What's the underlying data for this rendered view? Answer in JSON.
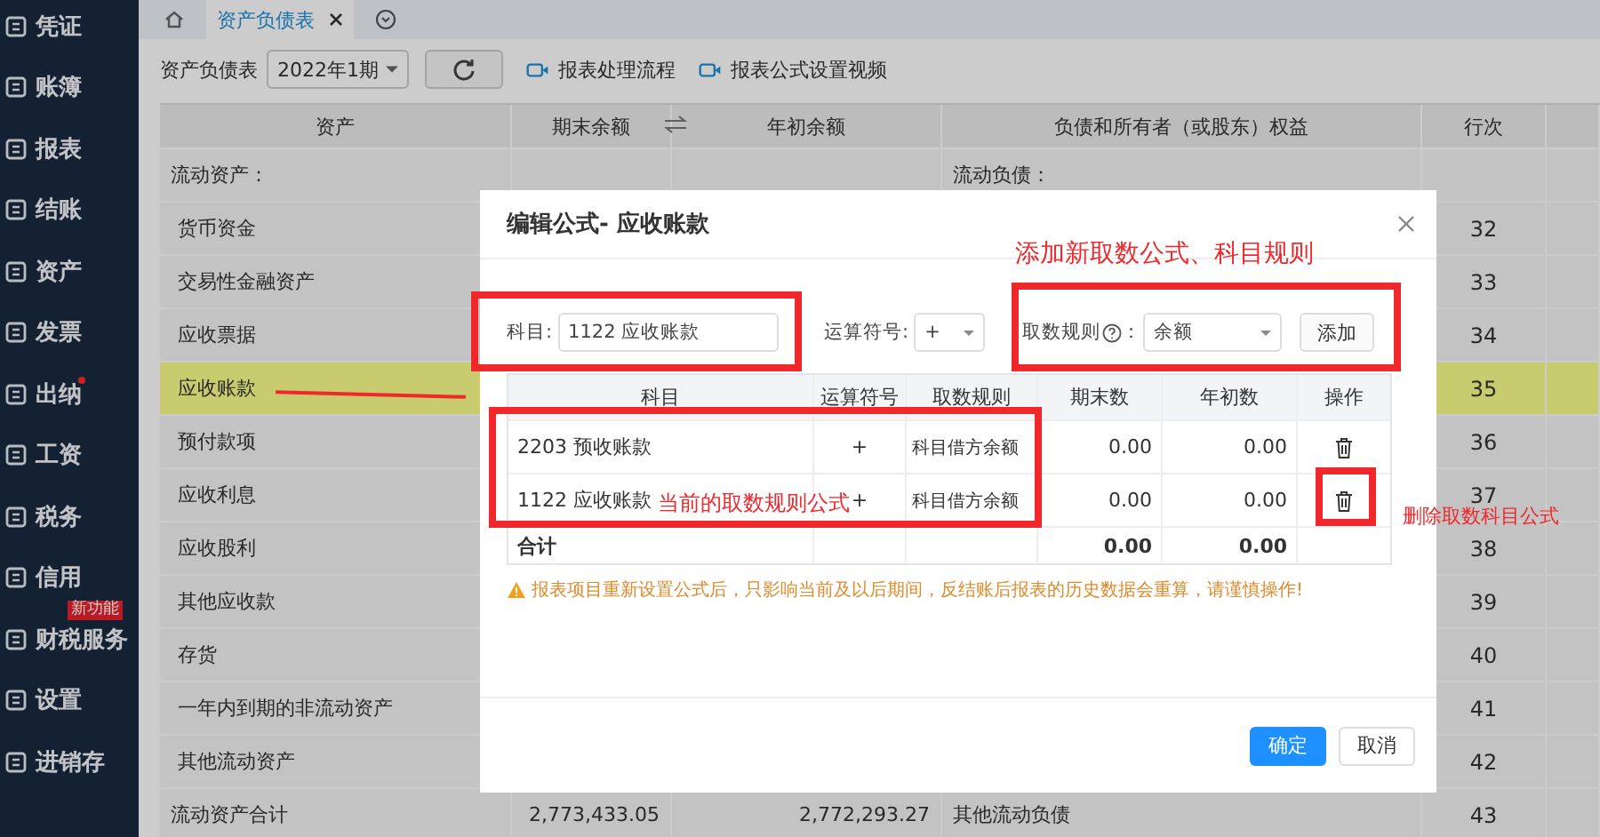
{
  "sidebar": {
    "items": [
      {
        "label": "凭证",
        "dot": false
      },
      {
        "label": "账簿",
        "dot": false
      },
      {
        "label": "报表",
        "dot": false
      },
      {
        "label": "结账",
        "dot": false
      },
      {
        "label": "资产",
        "dot": false
      },
      {
        "label": "发票",
        "dot": false
      },
      {
        "label": "出纳",
        "dot": true
      },
      {
        "label": "工资",
        "dot": false
      },
      {
        "label": "税务",
        "dot": false
      },
      {
        "label": "信用",
        "dot": false
      },
      {
        "label": "财税服务",
        "dot": false,
        "badge": "新功能"
      },
      {
        "label": "设置",
        "dot": false
      },
      {
        "label": "进销存",
        "dot": false
      }
    ]
  },
  "tabs": [
    {
      "label": "资产负债表",
      "selected": true
    }
  ],
  "toolbar": {
    "label": "资产负债表",
    "period": "2022年1期",
    "links": [
      "报表处理流程",
      "报表公式设置视频"
    ]
  },
  "sheet": {
    "columns": [
      "资产",
      "期末余额",
      "年初余额",
      "负债和所有者（或股东）权益",
      "行次"
    ],
    "rows": [
      {
        "asset": "流动资产：",
        "liability": "流动负债：",
        "selected": false,
        "kind": "section"
      },
      {
        "asset": "货币资金",
        "line": "32",
        "selected": false,
        "kind": "item"
      },
      {
        "asset": "交易性金融资产",
        "line": "33",
        "selected": false,
        "kind": "item"
      },
      {
        "asset": "应收票据",
        "line": "34",
        "selected": false,
        "kind": "item"
      },
      {
        "asset": "应收账款",
        "line": "35",
        "selected": true,
        "kind": "item"
      },
      {
        "asset": "预付款项",
        "line": "36",
        "selected": false,
        "kind": "item"
      },
      {
        "asset": "应收利息",
        "line": "37",
        "selected": false,
        "kind": "item"
      },
      {
        "asset": "应收股利",
        "line": "38",
        "selected": false,
        "kind": "item"
      },
      {
        "asset": "其他应收款",
        "line": "39",
        "selected": false,
        "kind": "item"
      },
      {
        "asset": "存货",
        "line": "40",
        "selected": false,
        "kind": "item"
      },
      {
        "asset": "一年内到期的非流动资产",
        "line": "41",
        "selected": false,
        "kind": "item"
      },
      {
        "asset": "其他流动资产",
        "line": "42",
        "selected": false,
        "kind": "item"
      },
      {
        "asset": "流动资产合计",
        "end": "2,773,433.05",
        "begin": "2,772,293.27",
        "liability": "其他流动负债",
        "line": "43",
        "selected": false,
        "kind": "section"
      }
    ]
  },
  "dialog": {
    "title": "编辑公式- 应收账款",
    "subject_label": "科目:",
    "subject_value": "1122 应收账款",
    "operator_label": "运算符号:",
    "operator": "+",
    "rule_label": "取数规则",
    "rule_colon": "：",
    "rule": "余额",
    "add_button": "添加",
    "columns": [
      "科目",
      "运算符号",
      "取数规则",
      "期末数",
      "年初数",
      "操作"
    ],
    "rows": [
      {
        "subject": "2203 预收账款",
        "operator": "+",
        "rule": "科目借方余额",
        "end": "0.00",
        "begin": "0.00"
      },
      {
        "subject": "1122 应收账款",
        "operator": "+",
        "rule": "科目借方余额",
        "end": "0.00",
        "begin": "0.00"
      }
    ],
    "total": {
      "label": "合计",
      "end": "0.00",
      "begin": "0.00"
    },
    "warning": "报表项目重新设置公式后，只影响当前及以后期间，反结账后报表的历史数据会重算，请谨慎操作!",
    "confirm": "确定",
    "cancel": "取消"
  },
  "annotations": {
    "add_note": "添加新取数公式、科目规则",
    "current_note": "当前的取数规则公式",
    "delete_note": "删除取数科目公式"
  }
}
